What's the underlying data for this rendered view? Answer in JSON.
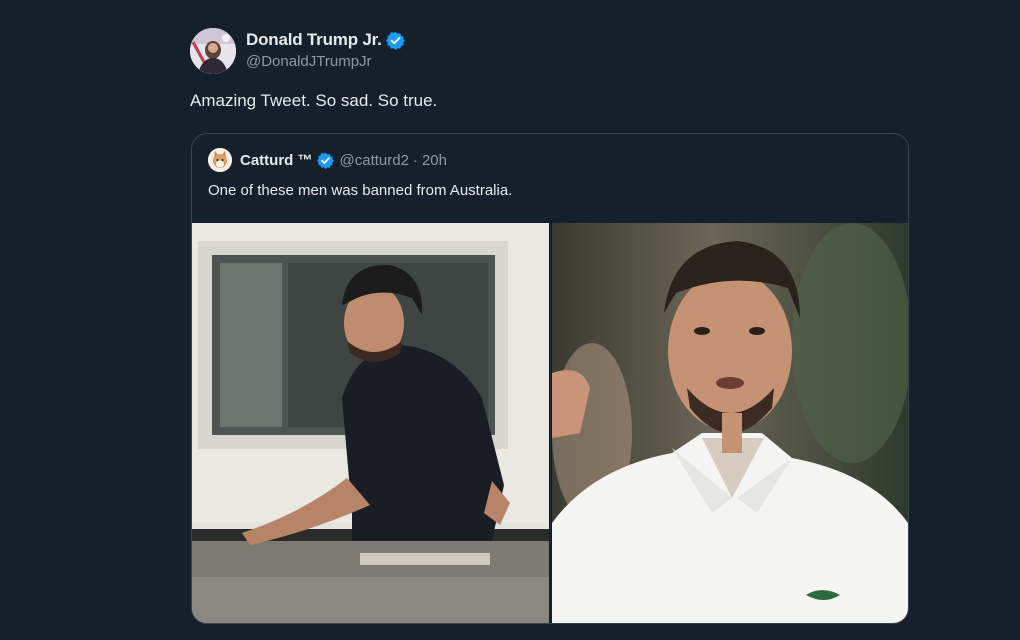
{
  "tweet": {
    "author_name": "Donald Trump Jr.",
    "author_handle": "@DonaldJTrumpJr",
    "verified": true,
    "text": "Amazing Tweet. So sad. So true."
  },
  "quote": {
    "author_name": "Catturd ™",
    "author_handle": "@catturd2",
    "separator": "·",
    "time": "20h",
    "verified": true,
    "text": "One of these men was banned from Australia.",
    "media": [
      {
        "icon": "photo-man-on-rooftop"
      },
      {
        "icon": "photo-tennis-player-fist"
      }
    ]
  },
  "colors": {
    "background": "#15202b",
    "verified_blue": "#1d9bf0",
    "secondary_text": "#8b98a5",
    "border": "#38444d"
  }
}
